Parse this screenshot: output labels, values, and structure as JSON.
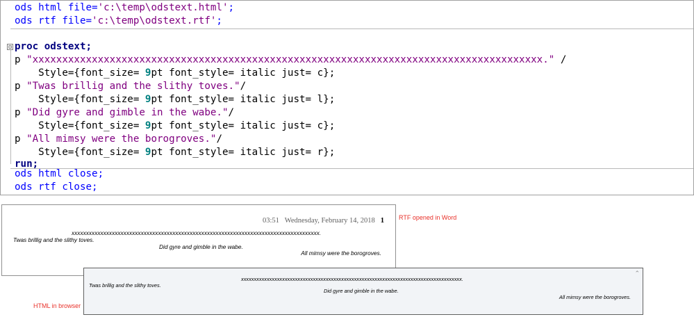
{
  "editor": {
    "line1": {
      "kw": "ods html file=",
      "str": "'c:\\temp\\odstext.html'",
      "end": ";"
    },
    "line2": {
      "kw": "ods rtf file=",
      "str": "'c:\\temp\\odstext.rtf'",
      "end": ";"
    },
    "fold_glyph": "⊟",
    "proc_line": "proc odstext;",
    "p_prefix": "p ",
    "p1_str": "\"xxxxxxxxxxxxxxxxxxxxxxxxxxxxxxxxxxxxxxxxxxxxxxxxxxxxxxxxxxxxxxxxxxxxxxxxxxxxxxxxxxxxxx.\"",
    "p1_tail": " /",
    "p2_str": "\"Twas brillig and the slithy toves.\"",
    "p3_str": "\"Did gyre and gimble in the wabe.\"",
    "p4_str": "\"All mimsy were the borogroves.\"",
    "slash": "/",
    "style_a": "    Style={font_size= ",
    "style_num": "9",
    "style_b": "pt font_style= italic just= ",
    "just1": "c};",
    "just2": "l};",
    "just3": "c};",
    "just4": "r};",
    "run_line": "run;",
    "close1": "ods html close;",
    "close2": "ods rtf close;"
  },
  "rtf": {
    "caption": "RTF opened in Word",
    "header_time": "03:51",
    "header_date": "Wednesday, February 14, 2018",
    "header_page": "1",
    "xline": "xxxxxxxxxxxxxxxxxxxxxxxxxxxxxxxxxxxxxxxxxxxxxxxxxxxxxxxxxxxxxxxxxxxxxxxxxxxxxxxxxxxxxx.",
    "line1": "Twas brillig and the slithy toves.",
    "line2": "Did gyre and gimble in the wabe.",
    "line3": "All mimsy were the borogroves."
  },
  "browser": {
    "caption": "HTML in browser",
    "scroll_glyph": "⌃",
    "xline": "xxxxxxxxxxxxxxxxxxxxxxxxxxxxxxxxxxxxxxxxxxxxxxxxxxxxxxxxxxxxxxxxxxxxxxxxxxxxxxxxxxxxxx.",
    "line1": "Twas brillig and the slithy toves.",
    "line2": "Did gyre and gimble in the wabe.",
    "line3": "All mimsy were the borogroves."
  },
  "colors": {
    "ods_keyword": "#0000ff",
    "string": "#800080",
    "proc_keyword": "#000080",
    "number": "#008080",
    "caption": "#e8312a"
  }
}
